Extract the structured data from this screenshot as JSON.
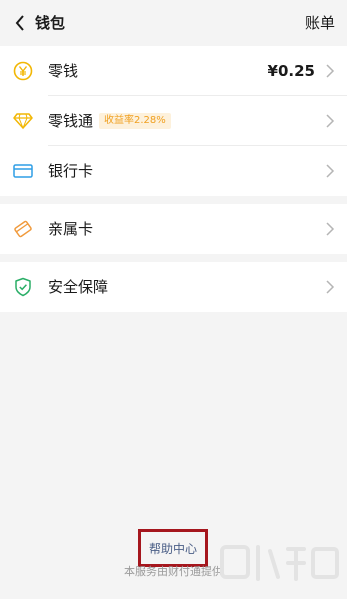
{
  "nav": {
    "title": "钱包",
    "bill_label": "账单"
  },
  "rows": [
    {
      "label": "零钱",
      "value": "¥0.25",
      "icon": "yen-coin-icon"
    },
    {
      "label": "零钱通",
      "tag": "收益率2.28%",
      "icon": "diamond-icon"
    },
    {
      "label": "银行卡",
      "icon": "bank-card-icon"
    },
    {
      "label": "亲属卡",
      "icon": "family-card-icon"
    },
    {
      "label": "安全保障",
      "icon": "shield-check-icon"
    }
  ],
  "help_label": "帮助中心",
  "footer_text": "本服务由财付通提供",
  "colors": {
    "accent_yellow": "#f2b705",
    "highlight_border": "#a5161d",
    "link_blue": "#4a5e86",
    "green": "#2aae67"
  }
}
